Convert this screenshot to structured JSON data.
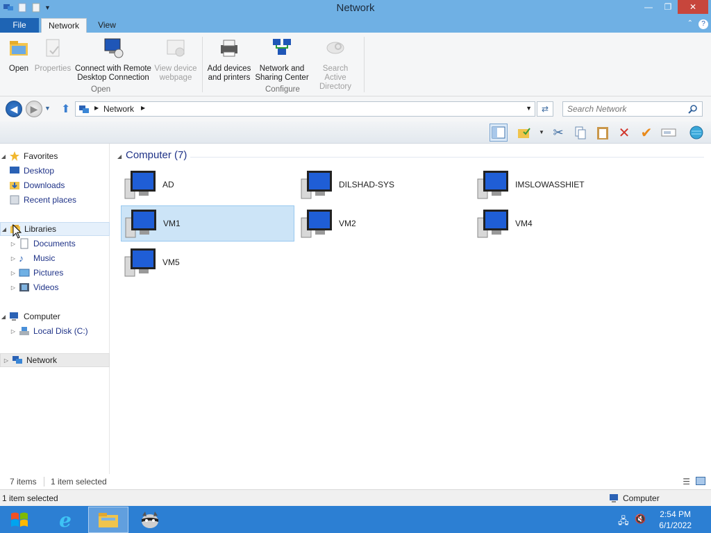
{
  "window": {
    "title": "Network"
  },
  "ribbon": {
    "tabs": {
      "file": "File",
      "network": "Network",
      "view": "View"
    },
    "buttons": {
      "open": "Open",
      "properties": "Properties",
      "connect_rdp_1": "Connect with Remote",
      "connect_rdp_2": "Desktop Connection",
      "view_device_1": "View device",
      "view_device_2": "webpage",
      "add_devices_1": "Add devices",
      "add_devices_2": "and printers",
      "nsc_1": "Network and",
      "nsc_2": "Sharing Center",
      "search_ad_1": "Search Active",
      "search_ad_2": "Directory"
    },
    "groups": {
      "open": "Open",
      "configure": "Configure"
    }
  },
  "address": {
    "crumb": "Network"
  },
  "search": {
    "placeholder": "Search Network"
  },
  "nav": {
    "favorites": "Favorites",
    "desktop": "Desktop",
    "downloads": "Downloads",
    "recent": "Recent places",
    "libraries": "Libraries",
    "documents": "Documents",
    "music": "Music",
    "pictures": "Pictures",
    "videos": "Videos",
    "computer": "Computer",
    "local_disk": "Local Disk (C:)",
    "network": "Network"
  },
  "content": {
    "group_header": "Computer (7)",
    "computers": [
      "AD",
      "DILSHAD-SYS",
      "IMSLOWASSHIET",
      "VM1",
      "VM2",
      "VM4",
      "VM5"
    ],
    "selected": "VM1"
  },
  "status": {
    "items": "7 items",
    "selected": "1 item selected",
    "bottom_selected": "1 item selected",
    "bottom_location": "Computer"
  },
  "taskbar": {
    "time": "2:54 PM",
    "date": "6/1/2022"
  },
  "colors": {
    "titlebar": "#6fb0e4",
    "taskbar": "#2c7fd3",
    "selection": "#cce4f7"
  }
}
